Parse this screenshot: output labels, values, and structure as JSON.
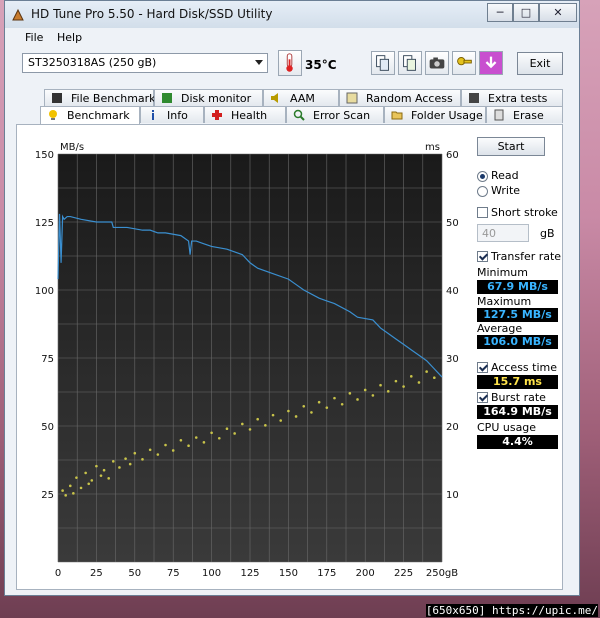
{
  "window": {
    "title": "HD Tune Pro 5.50 - Hard Disk/SSD Utility",
    "minimize": "─",
    "maximize": "□",
    "close": "✕"
  },
  "menu": [
    {
      "label": "File"
    },
    {
      "label": "Help"
    }
  ],
  "toolbar": {
    "drive": "ST3250318AS (250 gB)",
    "temperature": "35°C",
    "exit_label": "Exit",
    "icons": [
      "copy-text-icon",
      "copy-report-icon",
      "camera-icon",
      "save-key-icon",
      "download-icon"
    ]
  },
  "tabs_row1": [
    "File Benchmark",
    "Disk monitor",
    "AAM",
    "Random Access",
    "Extra tests"
  ],
  "tabs_row2": [
    "Benchmark",
    "Info",
    "Health",
    "Error Scan",
    "Folder Usage",
    "Erase"
  ],
  "controls": {
    "start_label": "Start",
    "read_label": "Read",
    "write_label": "Write",
    "short_stroke_label": "Short stroke",
    "short_stroke_value": "40",
    "short_stroke_unit": "gB",
    "transfer_rate_label": "Transfer rate",
    "minimum_label": "Minimum",
    "minimum_value": "67.9 MB/s",
    "maximum_label": "Maximum",
    "maximum_value": "127.5 MB/s",
    "average_label": "Average",
    "average_value": "106.0 MB/s",
    "access_time_label": "Access time",
    "access_time_value": "15.7 ms",
    "burst_rate_label": "Burst rate",
    "burst_rate_value": "164.9 MB/s",
    "cpu_usage_label": "CPU usage",
    "cpu_usage_value": "4.4%"
  },
  "colors": {
    "transfer_line": "#3a8fd0",
    "access_dots": "#c8c34a",
    "value_blue": "#39b4ff",
    "value_yellow": "#ffe34a",
    "value_white": "#ffffff"
  },
  "caption": "[650x650] https://upic.me/",
  "chart_data": {
    "type": "scatter",
    "left_axis_unit": "MB/s",
    "right_axis_unit": "ms",
    "x_ticks": [
      "0",
      "25",
      "50",
      "75",
      "100",
      "125",
      "150",
      "175",
      "200",
      "225",
      "250gB"
    ],
    "y_left_ticks": [
      "150",
      "125",
      "100",
      "75",
      "50",
      "25"
    ],
    "y_right_ticks": [
      "60",
      "50",
      "40",
      "30",
      "20",
      "10"
    ],
    "xlim": [
      0,
      250
    ],
    "ylim_left": [
      0,
      150
    ],
    "ylim_right": [
      0,
      60
    ],
    "grid": true,
    "series": [
      {
        "kind": "line",
        "x": [
          0,
          1,
          2,
          3,
          4,
          6,
          8,
          15,
          25,
          35,
          36,
          45,
          55,
          60,
          65,
          70,
          80,
          85,
          86,
          87,
          90,
          95,
          100,
          110,
          120,
          125,
          130,
          140,
          150,
          155,
          160,
          170,
          175,
          180,
          190,
          195,
          205,
          210,
          215,
          220,
          225,
          230,
          235,
          240,
          245,
          250
        ],
        "y": [
          104,
          128,
          110,
          127,
          126,
          127,
          127,
          126,
          125,
          125,
          123,
          123,
          122,
          122,
          121,
          121,
          120,
          118,
          113,
          118,
          118,
          117,
          116,
          115,
          113,
          110,
          108,
          106,
          104,
          102,
          100,
          97,
          96,
          95,
          92,
          90,
          89,
          86,
          84,
          82,
          80,
          78,
          76,
          74,
          71,
          68
        ]
      },
      {
        "kind": "points",
        "note_axis": "right",
        "x": [
          3,
          5,
          8,
          10,
          12,
          15,
          18,
          20,
          22,
          25,
          28,
          30,
          33,
          36,
          40,
          44,
          47,
          50,
          55,
          60,
          65,
          70,
          75,
          80,
          85,
          90,
          95,
          100,
          105,
          110,
          115,
          120,
          125,
          130,
          135,
          140,
          145,
          150,
          155,
          160,
          165,
          170,
          175,
          180,
          185,
          190,
          195,
          200,
          205,
          210,
          215,
          220,
          225,
          230,
          235,
          240,
          245
        ],
        "y": [
          10.5,
          9.8,
          11.2,
          10.1,
          12.4,
          10.9,
          13.1,
          11.5,
          12.0,
          14.1,
          12.7,
          13.5,
          12.3,
          14.8,
          13.9,
          15.2,
          14.4,
          16.0,
          15.1,
          16.5,
          15.8,
          17.2,
          16.4,
          17.9,
          17.1,
          18.3,
          17.6,
          19.0,
          18.2,
          19.6,
          18.9,
          20.3,
          19.5,
          21.0,
          20.1,
          21.6,
          20.8,
          22.2,
          21.4,
          22.9,
          22.0,
          23.5,
          22.7,
          24.1,
          23.2,
          24.8,
          23.9,
          25.3,
          24.5,
          26.0,
          25.1,
          26.6,
          25.8,
          27.3,
          26.4,
          28.0,
          27.1
        ]
      }
    ]
  }
}
